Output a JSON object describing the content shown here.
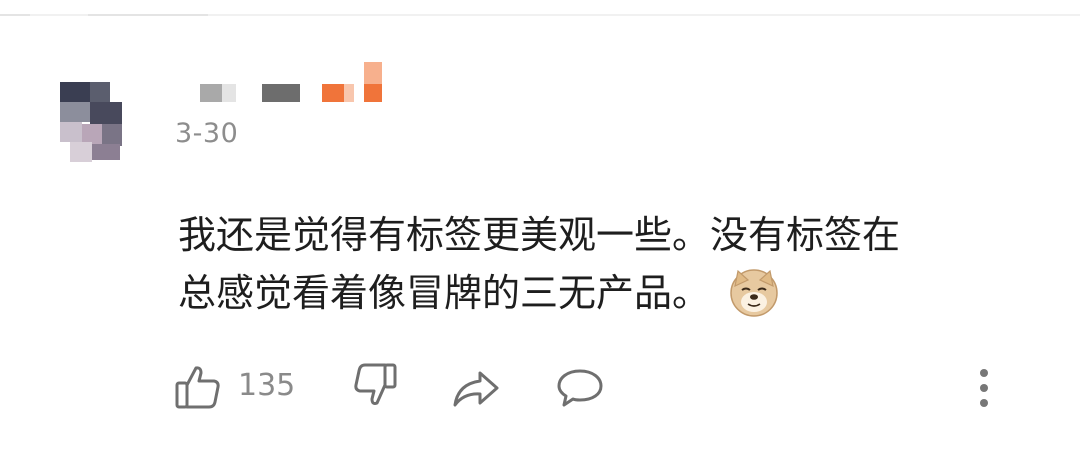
{
  "comment": {
    "timestamp": "3-30",
    "text_lines": [
      "我还是觉得有标签更美观一些。没有标签在",
      "总感觉看着像冒牌的三无产品。"
    ],
    "emoji_icon": "doge-face-icon"
  },
  "actions": {
    "like_icon": "thumbs-up-icon",
    "like_count": "135",
    "dislike_icon": "thumbs-down-icon",
    "share_icon": "share-arrow-icon",
    "reply_icon": "speech-bubble-icon",
    "more_icon": "vertical-ellipsis-icon"
  },
  "colors": {
    "text": "#1e1e1e",
    "muted": "#8d8d8d",
    "icon": "#6f6f6f",
    "username_accent": "#f0743a"
  }
}
